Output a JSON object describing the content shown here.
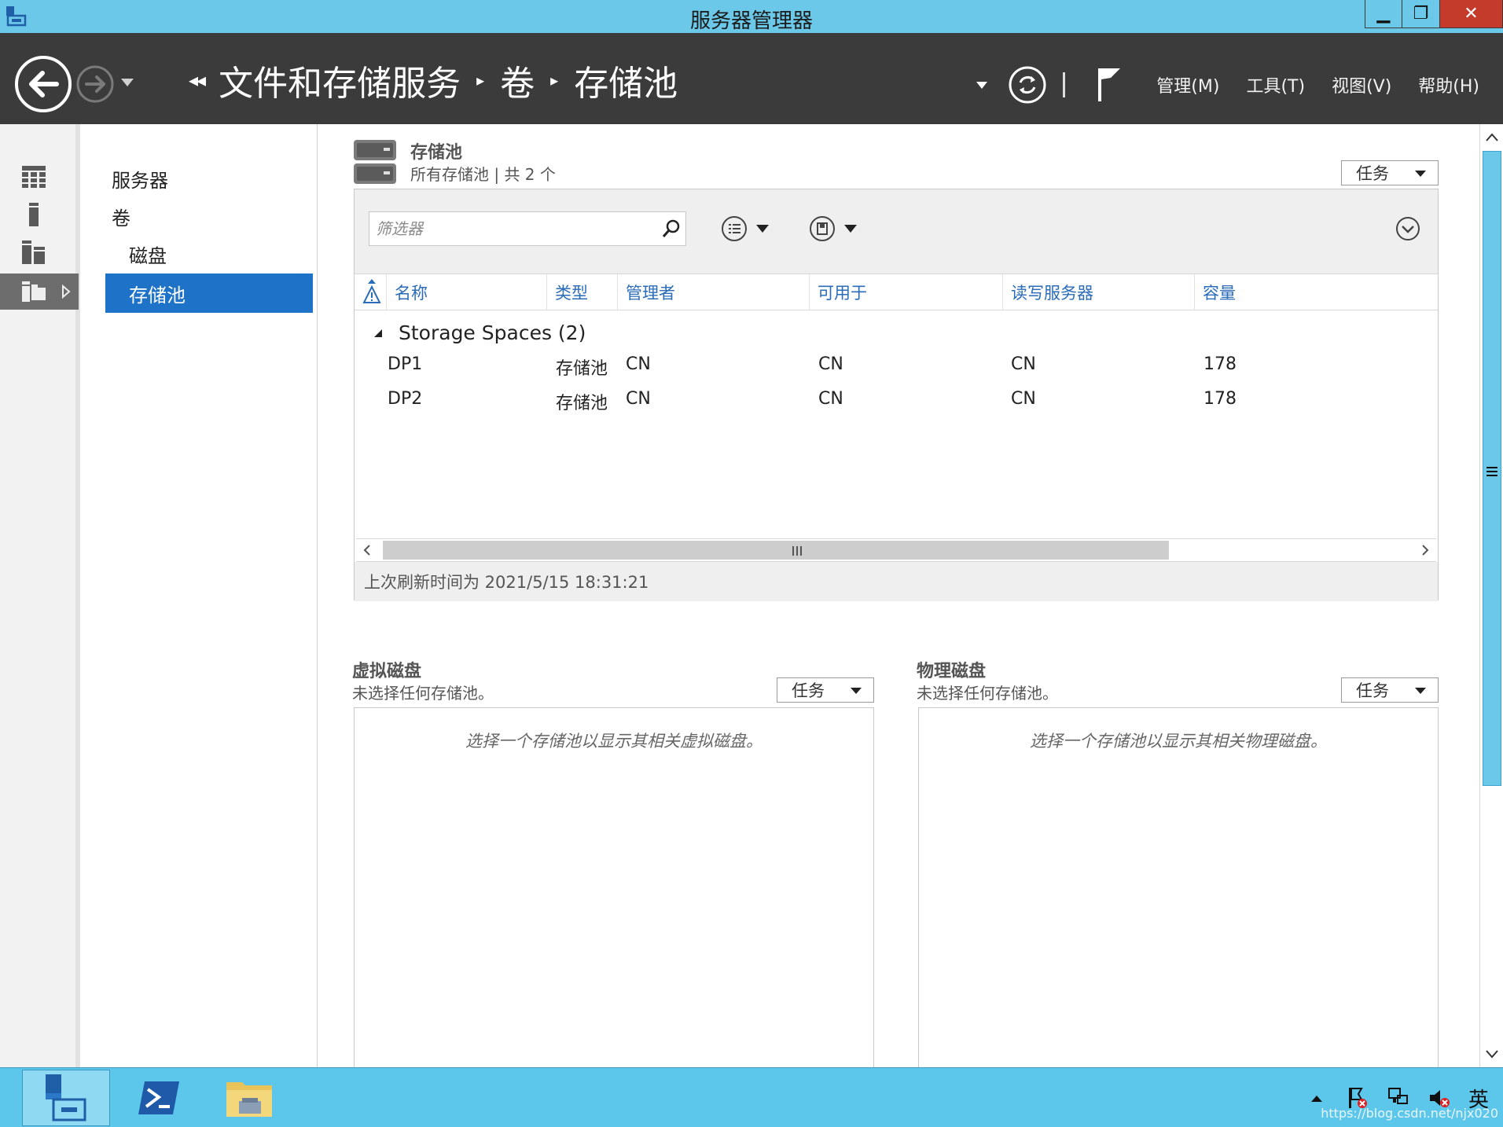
{
  "window": {
    "title": "服务器管理器",
    "controls": {
      "minimize": "▁",
      "maximize": "❐",
      "close": "✕"
    }
  },
  "header": {
    "breadcrumb": [
      "文件和存储服务",
      "卷",
      "存储池"
    ],
    "menus": [
      "管理(M)",
      "工具(T)",
      "视图(V)",
      "帮助(H)"
    ]
  },
  "rail": {
    "icons": [
      "dashboard-icon",
      "local-server-icon",
      "all-servers-icon",
      "file-storage-icon"
    ],
    "active_index": 3
  },
  "nav2": {
    "items": [
      {
        "label": "服务器",
        "selected": false
      },
      {
        "label": "卷",
        "selected": false
      },
      {
        "label": "磁盘",
        "selected": false
      },
      {
        "label": "存储池",
        "selected": true
      }
    ]
  },
  "pools_section": {
    "title": "存储池",
    "subtitle": "所有存储池 | 共 2 个",
    "tasks_label": "任务",
    "filter_placeholder": "筛选器",
    "columns": [
      "名称",
      "类型",
      "管理者",
      "可用于",
      "读写服务器",
      "容量"
    ],
    "group": {
      "label": "Storage Spaces (2)",
      "expanded": true
    },
    "rows": [
      {
        "name": "DP1",
        "type": "存储池",
        "managed_by": "CN",
        "available_to": "CN",
        "rw_server": "CN",
        "capacity": "178 G"
      },
      {
        "name": "DP2",
        "type": "存储池",
        "managed_by": "CN",
        "available_to": "CN",
        "rw_server": "CN",
        "capacity": "178 G"
      }
    ],
    "status": "上次刷新时间为 2021/5/15 18:31:21"
  },
  "virtual_disks": {
    "title": "虚拟磁盘",
    "subtitle": "未选择任何存储池。",
    "tasks_label": "任务",
    "hint": "选择一个存储池以显示其相关虚拟磁盘。"
  },
  "physical_disks": {
    "title": "物理磁盘",
    "subtitle": "未选择任何存储池。",
    "tasks_label": "任务",
    "hint": "选择一个存储池以显示其相关物理磁盘。"
  },
  "taskbar": {
    "apps": [
      "server-manager-icon",
      "powershell-icon",
      "file-explorer-icon"
    ],
    "ime": "英",
    "watermark": "https://blog.csdn.net/njx020"
  },
  "colors": {
    "titlebar": "#6bc8e8",
    "header": "#3b3b3b",
    "selection": "#1e73c8",
    "link": "#2b6cb8",
    "close": "#c43b2c"
  }
}
